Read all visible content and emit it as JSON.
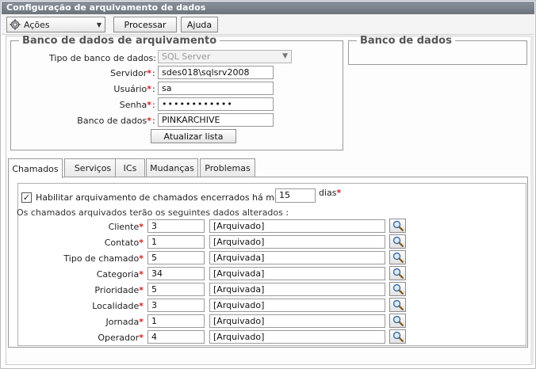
{
  "window": {
    "title": "Configuração de arquivamento de dados"
  },
  "toolbar": {
    "acoes_label": "Ações",
    "processar_label": "Processar",
    "ajuda_label": "Ajuda"
  },
  "archive_db": {
    "legend": "Banco de dados de arquivamento",
    "tipo_label": "Tipo de banco de dados:",
    "tipo_value": "SQL Server",
    "servidor_label": "Servidor",
    "servidor_value": "sdes018\\sqlsrv2008",
    "usuario_label": "Usuário",
    "usuario_value": "sa",
    "senha_label": "Senha",
    "senha_value": "••••••••••••",
    "banco_label": "Banco de dados",
    "banco_value": "PINKARCHIVE",
    "atualizar_label": "Atualizar lista",
    "required_mark": "*",
    "colon": ":"
  },
  "db": {
    "legend": "Banco de dados"
  },
  "tabs": [
    {
      "label": "Chamados"
    },
    {
      "label": "Serviços"
    },
    {
      "label": "ICs"
    },
    {
      "label": "Mudanças"
    },
    {
      "label": "Problemas"
    }
  ],
  "chamados": {
    "habilitar_text": "Habilitar arquivamento de chamados encerrados há mais de",
    "habilitar_checked": "✓",
    "dias_value": "15",
    "dias_label": "dias",
    "alterados_text": "Os chamados arquivados terão os seguintes dados alterados :",
    "rows": [
      {
        "label": "Cliente",
        "code": "3",
        "desc": "[Arquivado]"
      },
      {
        "label": "Contato",
        "code": "1",
        "desc": "[Arquivado]"
      },
      {
        "label": "Tipo de chamado",
        "code": "5",
        "desc": "[Arquivada]"
      },
      {
        "label": "Categoria",
        "code": "34",
        "desc": "[Arquivada]"
      },
      {
        "label": "Prioridade",
        "code": "5",
        "desc": "[Arquivada]"
      },
      {
        "label": "Localidade",
        "code": "3",
        "desc": "[Arquivado]"
      },
      {
        "label": "Jornada",
        "code": "1",
        "desc": "[Arquivado]"
      },
      {
        "label": "Operador",
        "code": "4",
        "desc": "[Arquivado]"
      }
    ]
  },
  "colors": {
    "title_bar": "#6b737c",
    "required": "#d42020",
    "border": "#9a9a9a"
  }
}
